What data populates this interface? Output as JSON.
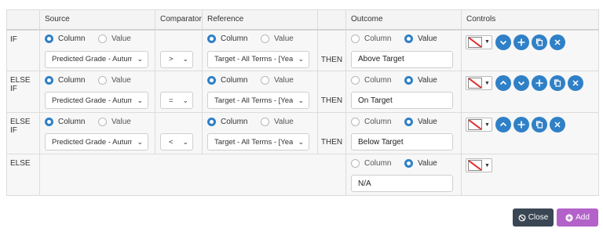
{
  "headers": [
    "",
    "Source",
    "Comparator",
    "Reference",
    "",
    "Outcome",
    "Controls"
  ],
  "radio_labels": {
    "column": "Column",
    "value": "Value"
  },
  "rows": [
    {
      "label": "IF",
      "source": "Predicted Grade - Autumn",
      "comparator": ">",
      "reference": "Target - All Terms - [YearG",
      "then": "THEN",
      "outcome": "Above Target"
    },
    {
      "label": "ELSE IF",
      "source": "Predicted Grade - Autumn",
      "comparator": "=",
      "reference": "Target - All Terms - [YearG",
      "then": "THEN",
      "outcome": "On Target"
    },
    {
      "label": "ELSE IF",
      "source": "Predicted Grade - Autumn",
      "comparator": "<",
      "reference": "Target - All Terms - [YearG",
      "then": "THEN",
      "outcome": "Below Target"
    },
    {
      "label": "ELSE",
      "outcome": "N/A"
    }
  ],
  "buttons": {
    "close": "Close",
    "add": "Add"
  },
  "colors": {
    "accent": "#2f80c7",
    "close_bg": "#3a4653",
    "add_bg": "#b262c8"
  }
}
